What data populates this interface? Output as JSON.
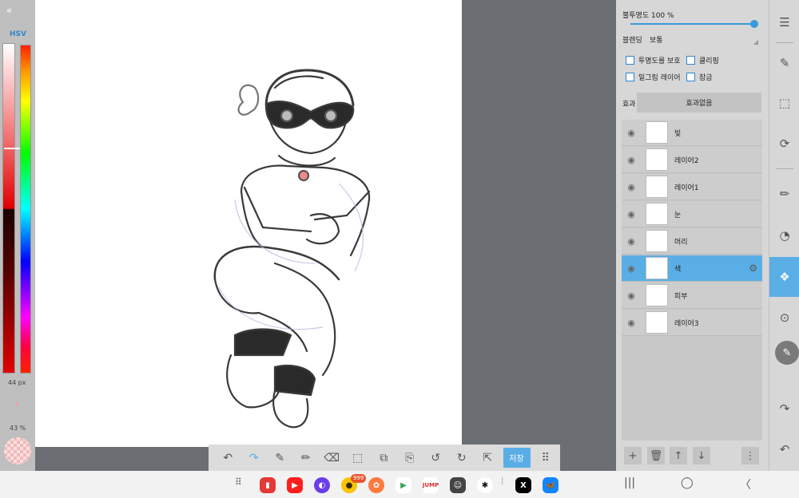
{
  "left_panel": {
    "hsv_label": "HSV",
    "brush_size": "44 px",
    "brush_opacity": "43 %",
    "current_color": "#f2b8b8"
  },
  "toolbar": {
    "save_label": "저장"
  },
  "layers_panel": {
    "opacity_label": "불투명도 100 %",
    "opacity_value": 100,
    "blend_label": "블렌딩",
    "blend_value": "보통",
    "checkboxes": {
      "protect_alpha": "투명도를 보호",
      "clipping": "클리핑",
      "draft_layer": "밑그림 레이어",
      "lock": "잠금"
    },
    "effect_label": "효과",
    "effect_value": "효과없음",
    "layers": [
      {
        "name": "빛",
        "selected": false
      },
      {
        "name": "레이어2",
        "selected": false
      },
      {
        "name": "레이어1",
        "selected": false
      },
      {
        "name": "눈",
        "selected": false
      },
      {
        "name": "머리",
        "selected": false
      },
      {
        "name": "색",
        "selected": true
      },
      {
        "name": "피부",
        "selected": false
      },
      {
        "name": "레이어3",
        "selected": false
      }
    ]
  },
  "taskbar": {
    "badge_count": "999",
    "jump_label": "JUMP"
  },
  "colors": {
    "accent": "#5aaee6",
    "slider": "#3a9ad9"
  }
}
